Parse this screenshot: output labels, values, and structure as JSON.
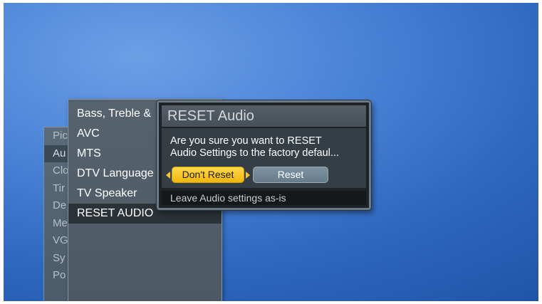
{
  "main_menu": {
    "items": [
      {
        "label": "Pic"
      },
      {
        "label": "Au",
        "active": true
      },
      {
        "label": "Clo"
      },
      {
        "label": "Tir"
      },
      {
        "label": "De"
      },
      {
        "label": "Me"
      },
      {
        "label": "VG"
      },
      {
        "label": "Sy"
      },
      {
        "label": "Po"
      }
    ]
  },
  "audio_menu": {
    "items": [
      {
        "label": "Bass, Treble &"
      },
      {
        "label": "AVC"
      },
      {
        "label": "MTS"
      },
      {
        "label": "DTV Language"
      },
      {
        "label": "TV Speaker"
      },
      {
        "label": "RESET AUDIO",
        "selected": true
      }
    ]
  },
  "dialog": {
    "title": "RESET Audio",
    "message_line1": "Are you sure you want to RESET",
    "message_line2": "Audio Settings to the factory defaul...",
    "dont_reset_label": "Don't Reset",
    "reset_label": "Reset",
    "hint": "Leave Audio settings as-is"
  },
  "colors": {
    "background_blue": "#4a82d6",
    "focus_yellow": "#f6c623",
    "button_gray": "#74899a"
  }
}
